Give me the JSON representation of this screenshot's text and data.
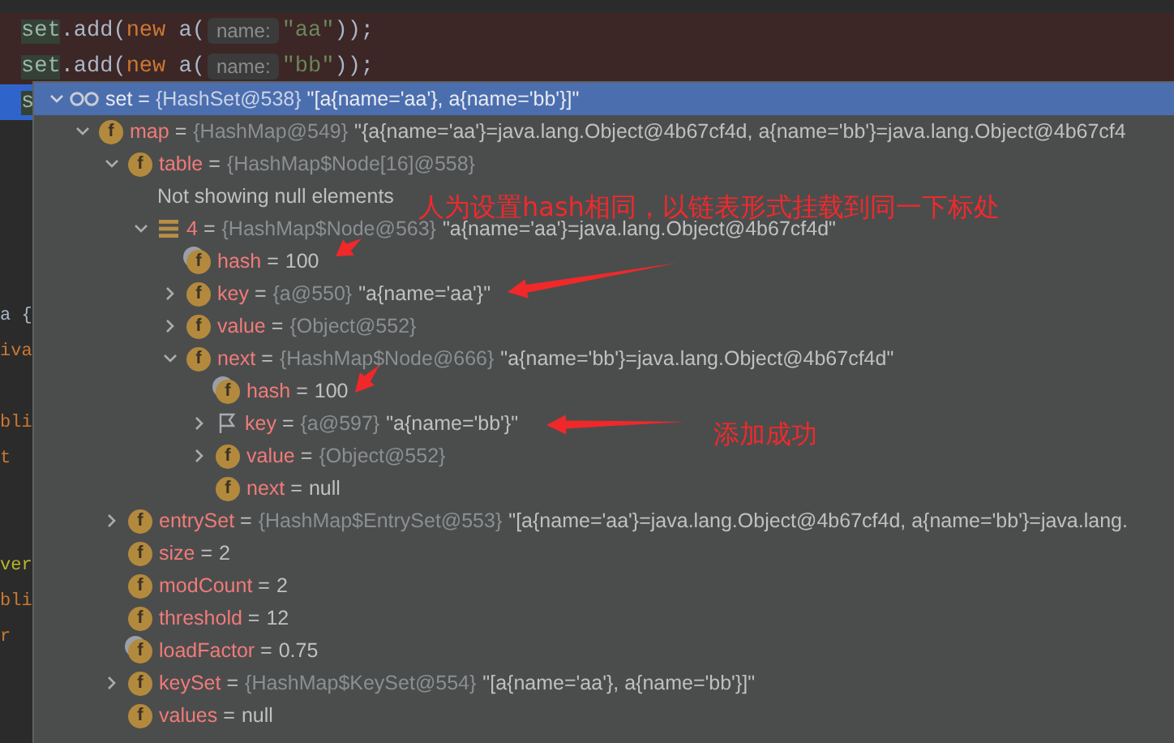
{
  "editor": {
    "lines": [
      {
        "kind": "breakpoint",
        "segments": [
          {
            "kind": "var",
            "text": "set"
          },
          {
            "kind": "plain",
            "text": ".add("
          },
          {
            "kind": "keyword",
            "text": "new"
          },
          {
            "kind": "plain",
            "text": " a("
          },
          {
            "kind": "hint",
            "text": "name:"
          },
          {
            "kind": "string",
            "text": "\"aa\""
          },
          {
            "kind": "plain",
            "text": "));"
          }
        ]
      },
      {
        "kind": "breakpoint",
        "segments": [
          {
            "kind": "var",
            "text": "set"
          },
          {
            "kind": "plain",
            "text": ".add("
          },
          {
            "kind": "keyword",
            "text": "new"
          },
          {
            "kind": "plain",
            "text": " a("
          },
          {
            "kind": "hint",
            "text": "name:"
          },
          {
            "kind": "string",
            "text": "\"bb\""
          },
          {
            "kind": "plain",
            "text": "));"
          }
        ]
      },
      {
        "kind": "current",
        "segments": [
          {
            "kind": "var",
            "text": "s"
          }
        ]
      },
      {
        "kind": "blank"
      },
      {
        "kind": "blank"
      },
      {
        "kind": "blank"
      },
      {
        "kind": "blank"
      },
      {
        "kind": "blank"
      },
      {
        "kind": "fragment",
        "segments": [
          {
            "kind": "plain",
            "text": "a {"
          }
        ]
      },
      {
        "kind": "fragment",
        "segments": [
          {
            "kind": "keyword",
            "text": "iva"
          }
        ]
      },
      {
        "kind": "blank"
      },
      {
        "kind": "fragment",
        "segments": [
          {
            "kind": "keyword",
            "text": "bli"
          }
        ]
      },
      {
        "kind": "fragment",
        "segments": [
          {
            "kind": "keyword",
            "text": "t"
          }
        ]
      },
      {
        "kind": "blank"
      },
      {
        "kind": "blank"
      },
      {
        "kind": "fragment",
        "segments": [
          {
            "kind": "annotation",
            "text": "ver"
          }
        ]
      },
      {
        "kind": "fragment",
        "segments": [
          {
            "kind": "keyword",
            "text": "bli"
          }
        ]
      },
      {
        "kind": "fragment",
        "segments": [
          {
            "kind": "keyword",
            "text": "r"
          }
        ]
      }
    ]
  },
  "debugger": {
    "root": {
      "kind": "watch",
      "name": "set",
      "eq": "=",
      "type": "{HashSet@538}",
      "value": "\"[a{name='aa'}, a{name='bb'}]\"",
      "expanded": true,
      "children": [
        {
          "kind": "field",
          "icon_letter": "f",
          "name": "map",
          "eq": "=",
          "type": "{HashMap@549}",
          "value": "\"{a{name='aa'}=java.lang.Object@4b67cf4d, a{name='bb'}=java.lang.Object@4b67cf4",
          "expanded": true,
          "children": [
            {
              "kind": "field",
              "icon_letter": "f",
              "name": "table",
              "eq": "=",
              "type": "{HashMap$Node[16]@558}",
              "expanded": true,
              "children": [
                {
                  "kind": "note",
                  "note": "Not showing null elements"
                },
                {
                  "kind": "element",
                  "name": "4",
                  "eq": "=",
                  "type": "{HashMap$Node@563}",
                  "value": "\"a{name='aa'}=java.lang.Object@4b67cf4d\"",
                  "expanded": true,
                  "children": [
                    {
                      "kind": "field",
                      "icon_letter": "f",
                      "final": true,
                      "name": "hash",
                      "eq": "=",
                      "value": "100"
                    },
                    {
                      "kind": "field",
                      "icon_letter": "f",
                      "name": "key",
                      "eq": "=",
                      "type": "{a@550}",
                      "value": "\"a{name='aa'}\"",
                      "expanded": false
                    },
                    {
                      "kind": "field",
                      "icon_letter": "f",
                      "name": "value",
                      "eq": "=",
                      "type": "{Object@552}",
                      "expanded": false
                    },
                    {
                      "kind": "field",
                      "icon_letter": "f",
                      "name": "next",
                      "eq": "=",
                      "type": "{HashMap$Node@666}",
                      "value": "\"a{name='bb'}=java.lang.Object@4b67cf4d\"",
                      "expanded": true,
                      "children": [
                        {
                          "kind": "field",
                          "icon_letter": "f",
                          "final": true,
                          "name": "hash",
                          "eq": "=",
                          "value": "100"
                        },
                        {
                          "kind": "marked",
                          "name": "key",
                          "eq": "=",
                          "type": "{a@597}",
                          "value": "\"a{name='bb'}\"",
                          "expanded": false
                        },
                        {
                          "kind": "field",
                          "icon_letter": "f",
                          "name": "value",
                          "eq": "=",
                          "type": "{Object@552}",
                          "expanded": false
                        },
                        {
                          "kind": "field",
                          "icon_letter": "f",
                          "name": "next",
                          "eq": "=",
                          "value": "null"
                        }
                      ]
                    }
                  ]
                }
              ]
            },
            {
              "kind": "field",
              "icon_letter": "f",
              "name": "entrySet",
              "eq": "=",
              "type": "{HashMap$EntrySet@553}",
              "value": "\"[a{name='aa'}=java.lang.Object@4b67cf4d, a{name='bb'}=java.lang.",
              "expanded": false
            },
            {
              "kind": "field",
              "icon_letter": "f",
              "name": "size",
              "eq": "=",
              "value": "2"
            },
            {
              "kind": "field",
              "icon_letter": "f",
              "name": "modCount",
              "eq": "=",
              "value": "2"
            },
            {
              "kind": "field",
              "icon_letter": "f",
              "name": "threshold",
              "eq": "=",
              "value": "12"
            },
            {
              "kind": "field",
              "icon_letter": "f",
              "final": true,
              "name": "loadFactor",
              "eq": "=",
              "value": "0.75"
            },
            {
              "kind": "field",
              "icon_letter": "f",
              "name": "keySet",
              "eq": "=",
              "type": "{HashMap$KeySet@554}",
              "value": "\"[a{name='aa'}, a{name='bb'}]\"",
              "expanded": false
            },
            {
              "kind": "field",
              "icon_letter": "f",
              "name": "values",
              "eq": "=",
              "value": "null"
            }
          ]
        }
      ]
    }
  },
  "annotations": [
    {
      "text": "人为设置hash相同，以链表形式挂载到同一下标处"
    },
    {
      "text": "添加成功"
    }
  ]
}
